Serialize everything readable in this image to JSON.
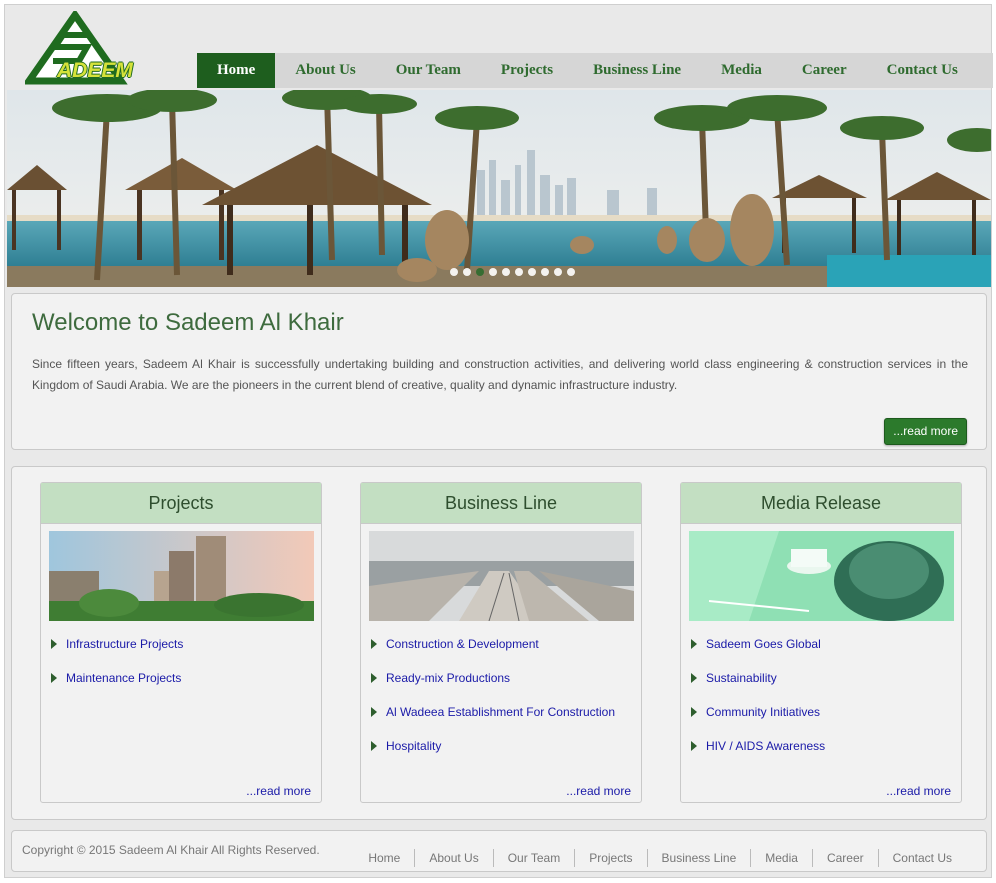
{
  "brand": {
    "logo_text": "ADEEM",
    "logo_icon": "sadeem-logo-icon",
    "accent": "#1e5e1e"
  },
  "nav": {
    "items": [
      "Home",
      "About Us",
      "Our Team",
      "Projects",
      "Business Line",
      "Media",
      "Career",
      "Contact Us"
    ],
    "active": "Home"
  },
  "banner": {
    "slide_count": 10,
    "active_slide": 3
  },
  "welcome": {
    "title": "Welcome to Sadeem Al Khair",
    "text": "Since fifteen years, Sadeem Al Khair is successfully undertaking building and construction activities, and delivering world class engineering & construction services in the Kingdom of Saudi Arabia. We are the pioneers in the current blend of creative, quality and dynamic infrastructure industry.",
    "read_more": "...read more"
  },
  "cards": [
    {
      "title": "Projects",
      "links": [
        "Infrastructure Projects",
        "Maintenance Projects"
      ],
      "more": "...read more"
    },
    {
      "title": "Business Line",
      "links": [
        "Construction & Development",
        "Ready-mix Productions",
        "Al Wadeea Establishment For Construction",
        "Hospitality"
      ],
      "more": "...read more"
    },
    {
      "title": "Media Release",
      "links": [
        "Sadeem Goes Global",
        "Sustainability",
        "Community Initiatives",
        "HIV / AIDS Awareness"
      ],
      "more": "...read more"
    }
  ],
  "footer": {
    "copyright": "Copyright © 2015 Sadeem Al Khair All Rights Reserved.",
    "links": [
      "Home",
      "About Us",
      "Our Team",
      "Projects",
      "Business Line",
      "Media",
      "Career",
      "Contact Us"
    ]
  }
}
